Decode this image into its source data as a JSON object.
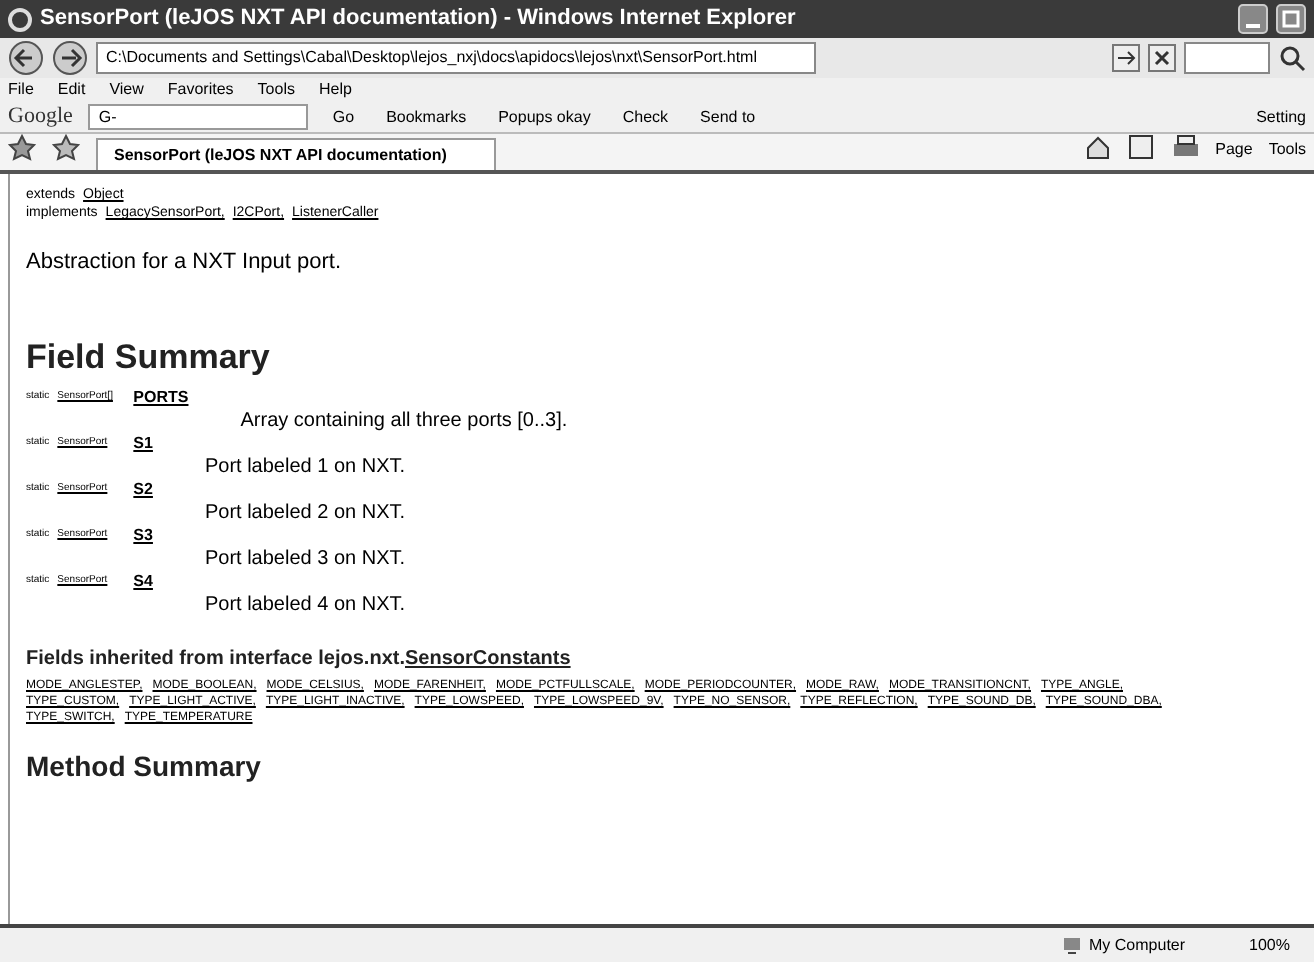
{
  "window": {
    "title": "SensorPort (leJOS NXT API documentation) - Windows Internet Explorer"
  },
  "address_bar": {
    "value": "C:\\Documents and Settings\\Cabal\\Desktop\\lejos_nxj\\docs\\apidocs\\lejos\\nxt\\SensorPort.html"
  },
  "menu": [
    "File",
    "Edit",
    "View",
    "Favorites",
    "Tools",
    "Help"
  ],
  "google_toolbar": {
    "logo": "Google",
    "search_label": "G-",
    "buttons": [
      "Go",
      "Bookmarks",
      "Popups okay",
      "Check",
      "Send to"
    ],
    "settings": "Setting"
  },
  "tab": {
    "title": "SensorPort (leJOS NXT API documentation)"
  },
  "command_bar": [
    "Page",
    "Tools"
  ],
  "content": {
    "extends": {
      "label": "extends",
      "link": "Object"
    },
    "implements": {
      "label": "implements",
      "links": [
        "LegacySensorPort,",
        "I2CPort,",
        "ListenerCaller"
      ]
    },
    "description": "Abstraction for a NXT Input port.",
    "field_summary": {
      "heading": "Field Summary",
      "fields": [
        {
          "modifier": "static",
          "type": "SensorPort[]",
          "name": "PORTS",
          "description": "Array containing all three ports [0..3]."
        },
        {
          "modifier": "static",
          "type": "SensorPort",
          "name": "S1",
          "description": "Port labeled 1 on NXT."
        },
        {
          "modifier": "static",
          "type": "SensorPort",
          "name": "S2",
          "description": "Port labeled 2 on NXT."
        },
        {
          "modifier": "static",
          "type": "SensorPort",
          "name": "S3",
          "description": "Port labeled 3 on NXT."
        },
        {
          "modifier": "static",
          "type": "SensorPort",
          "name": "S4",
          "description": "Port labeled 4 on NXT."
        }
      ]
    },
    "inherited": {
      "heading": "Fields inherited from interface lejos.nxt.",
      "link": "SensorConstants",
      "constants": [
        "MODE_ANGLESTEP,",
        "MODE_BOOLEAN,",
        "MODE_CELSIUS,",
        "MODE_FARENHEIT,",
        "MODE_PCTFULLSCALE,",
        "MODE_PERIODCOUNTER,",
        "MODE_RAW,",
        "MODE_TRANSITIONCNT,",
        "TYPE_ANGLE,",
        "TYPE_CUSTOM,",
        "TYPE_LIGHT_ACTIVE,",
        "TYPE_LIGHT_INACTIVE,",
        "TYPE_LOWSPEED,",
        "TYPE_LOWSPEED_9V,",
        "TYPE_NO_SENSOR,",
        "TYPE_REFLECTION,",
        "TYPE_SOUND_DB,",
        "TYPE_SOUND_DBA,",
        "TYPE_SWITCH,",
        "TYPE_TEMPERATURE"
      ]
    },
    "method_summary": {
      "heading": "Method Summary"
    }
  },
  "status_bar": {
    "zone": "My Computer",
    "zoom": "100%"
  }
}
